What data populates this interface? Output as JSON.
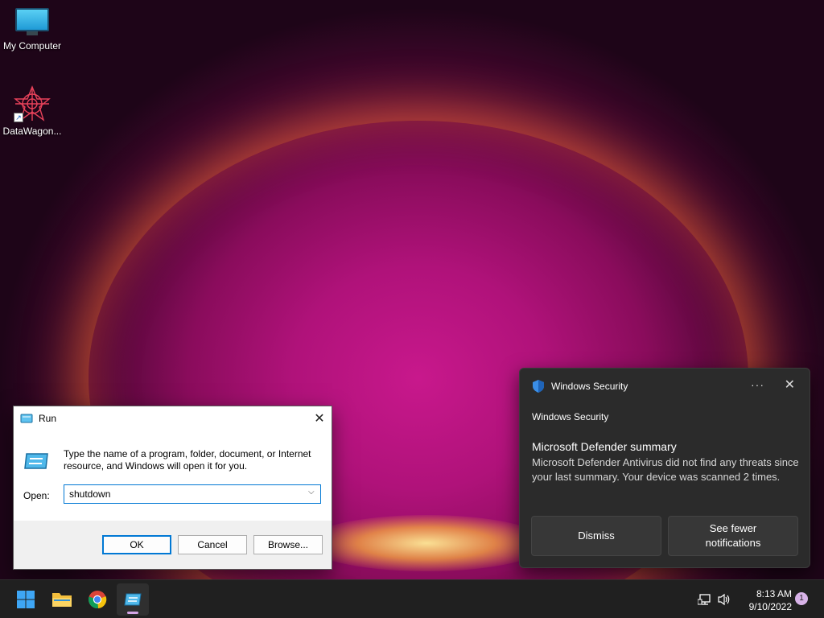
{
  "desktop": {
    "icons": [
      {
        "label": "My Computer"
      },
      {
        "label": "DataWagon..."
      }
    ]
  },
  "run_dialog": {
    "title": "Run",
    "description": "Type the name of a program, folder, document, or Internet resource, and Windows will open it for you.",
    "open_label": "Open:",
    "input_value": "shutdown",
    "ok_label": "OK",
    "cancel_label": "Cancel",
    "browse_label": "Browse..."
  },
  "toast": {
    "header_title": "Windows Security",
    "app_name": "Windows Security",
    "message_title": "Microsoft Defender summary",
    "message_body": "Microsoft Defender Antivirus did not find any threats since your last summary. Your device was scanned 2 times.",
    "dismiss_label": "Dismiss",
    "fewer_label": "See fewer notifications",
    "more_icon": "more-options-icon",
    "close_icon": "close-icon"
  },
  "taskbar": {
    "items": [
      "start-icon",
      "file-explorer-icon",
      "chrome-icon",
      "run-icon"
    ],
    "time": "8:13 AM",
    "date": "9/10/2022",
    "notification_count": "1",
    "accent": "#d4a5e6"
  }
}
